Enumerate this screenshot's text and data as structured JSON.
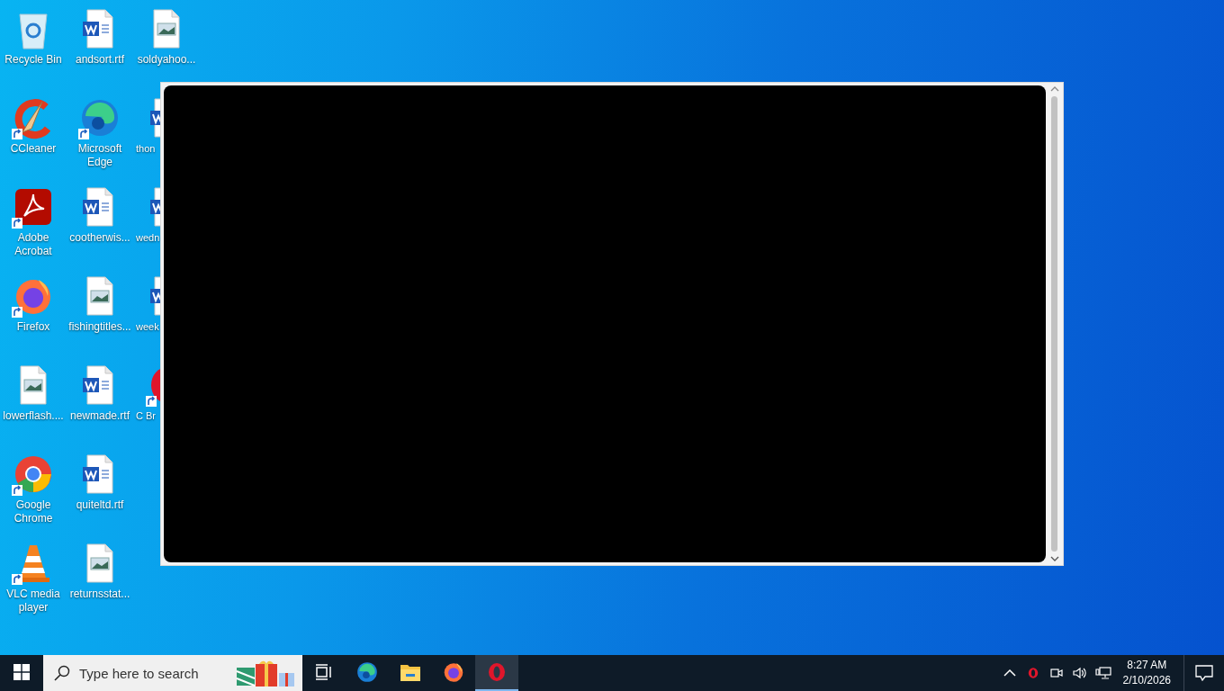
{
  "desktop": {
    "columns": [
      [
        {
          "label": "Recycle Bin",
          "kind": "recycle",
          "shortcut": false
        },
        {
          "label": "CCleaner",
          "kind": "ccleaner",
          "shortcut": true
        },
        {
          "label": "Adobe Acrobat",
          "kind": "acrobat",
          "shortcut": true
        },
        {
          "label": "Firefox",
          "kind": "firefox",
          "shortcut": true
        },
        {
          "label": "lowerflash....",
          "kind": "image",
          "shortcut": false
        },
        {
          "label": "Google Chrome",
          "kind": "chrome",
          "shortcut": true
        },
        {
          "label": "VLC media player",
          "kind": "vlc",
          "shortcut": true
        }
      ],
      [
        {
          "label": "andsort.rtf",
          "kind": "word",
          "shortcut": false
        },
        {
          "label": "Microsoft Edge",
          "kind": "edge",
          "shortcut": true
        },
        {
          "label": "cootherwis...",
          "kind": "word",
          "shortcut": false
        },
        {
          "label": "fishingtitles...",
          "kind": "image",
          "shortcut": false
        },
        {
          "label": "newmade.rtf",
          "kind": "word",
          "shortcut": false
        },
        {
          "label": "quiteltd.rtf",
          "kind": "word",
          "shortcut": false
        },
        {
          "label": "returnsstat...",
          "kind": "image",
          "shortcut": false
        }
      ],
      [
        {
          "label": "soldyahoo...",
          "kind": "image",
          "shortcut": false
        },
        {
          "label": "thon",
          "kind": "word",
          "shortcut": false
        },
        {
          "label": "wedn",
          "kind": "word",
          "shortcut": false
        },
        {
          "label": "week",
          "kind": "word",
          "shortcut": false
        },
        {
          "label": "C Br",
          "kind": "opera",
          "shortcut": true
        }
      ]
    ]
  },
  "taskbar": {
    "search": {
      "placeholder": "Type here to search"
    },
    "apps": [
      {
        "kind": "taskview",
        "selected": false
      },
      {
        "kind": "edge",
        "selected": false
      },
      {
        "kind": "explorer",
        "selected": false
      },
      {
        "kind": "firefox",
        "selected": false
      },
      {
        "kind": "opera",
        "selected": true
      }
    ],
    "tray": [
      {
        "kind": "chevron"
      },
      {
        "kind": "opera"
      },
      {
        "kind": "meet"
      },
      {
        "kind": "volume"
      },
      {
        "kind": "network"
      }
    ],
    "clock": {
      "time": "8:27 AM",
      "date": "2/10/2026"
    }
  }
}
